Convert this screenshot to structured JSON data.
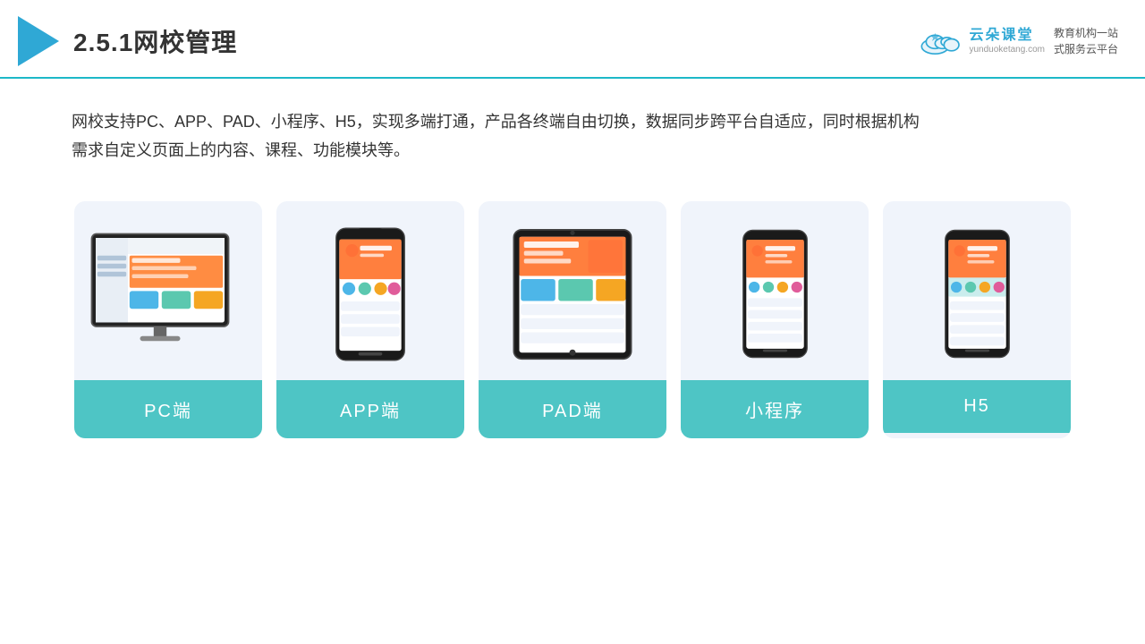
{
  "header": {
    "title": "2.5.1网校管理",
    "logo": {
      "main": "云朵课堂",
      "url": "yunduoketang.com",
      "tagline1": "教育机构一站",
      "tagline2": "式服务云平台"
    }
  },
  "description": {
    "text": "网校支持PC、APP、PAD、小程序、H5，实现多端打通，产品各终端自由切换，数据同步跨平台自适应，同时根据机构需求自定义页面上的内容、课程、功能模块等。"
  },
  "cards": [
    {
      "id": "pc",
      "label": "PC端",
      "type": "pc"
    },
    {
      "id": "app",
      "label": "APP端",
      "type": "phone"
    },
    {
      "id": "pad",
      "label": "PAD端",
      "type": "tablet"
    },
    {
      "id": "mini",
      "label": "小程序",
      "type": "phone2"
    },
    {
      "id": "h5",
      "label": "H5",
      "type": "phone3"
    }
  ],
  "colors": {
    "accent": "#4ec5c5",
    "header_line": "#1db8c8",
    "triangle": "#2fa8d5",
    "card_bg": "#f0f4fb",
    "text_dark": "#333333"
  }
}
